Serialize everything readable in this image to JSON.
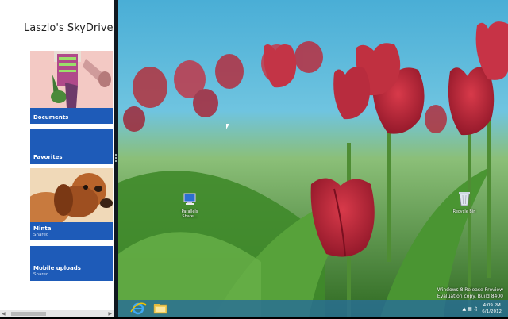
{
  "skydrive": {
    "title": "Laszlo's SkyDrive",
    "tiles": [
      {
        "label": "Documents",
        "sub": ""
      },
      {
        "label": "Favorites",
        "sub": ""
      },
      {
        "label": "Minta",
        "sub": "Shared"
      },
      {
        "label": "Mobile uploads",
        "sub": "Shared"
      }
    ]
  },
  "desktop": {
    "icons": [
      {
        "label": "Parallels Share..."
      },
      {
        "label": "Recycle Bin"
      }
    ],
    "watermark": {
      "line1": "Windows 8 Release Preview",
      "line2": "Evaluation copy. Build 8400"
    }
  },
  "taskbar": {
    "time": "4:09 PM",
    "date": "6/1/2012"
  },
  "colors": {
    "tile_blue": "#1e5bb8",
    "taskbar": "#2a6e96"
  }
}
